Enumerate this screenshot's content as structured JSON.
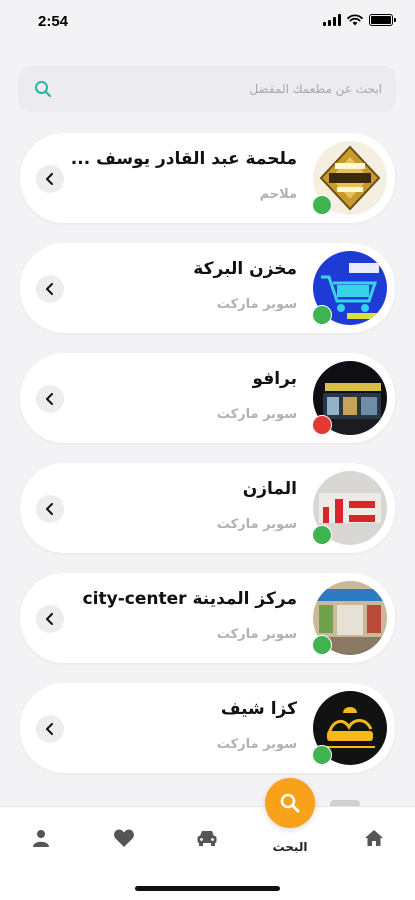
{
  "status_bar": {
    "time": "2:54"
  },
  "search": {
    "placeholder": "ابحث عن مطعمك المفضل"
  },
  "colors": {
    "accent": "#f7a21a",
    "online": "#3fb34f",
    "offline": "#e53935",
    "search_icon": "#27b3a8"
  },
  "stores": [
    {
      "name": "ملحمة عبد القادر يوسف ...",
      "category": "ملاحم",
      "status": "open",
      "icon": "butcher-logo"
    },
    {
      "name": "مخزن البركة",
      "category": "سوبر ماركت",
      "status": "open",
      "icon": "cart-logo"
    },
    {
      "name": "برافو",
      "category": "سوبر ماركت",
      "status": "closed",
      "icon": "storefront-photo"
    },
    {
      "name": "المازن",
      "category": "سوبر ماركت",
      "status": "open",
      "icon": "mazen-logo"
    },
    {
      "name": "مركز المدينة city-center",
      "category": "سوبر ماركت",
      "status": "open",
      "icon": "shop-photo"
    },
    {
      "name": "كزا شيف",
      "category": "سوبر ماركت",
      "status": "open",
      "icon": "chef-logo"
    }
  ],
  "nav": {
    "active_label": "البحث",
    "items": [
      "home-icon",
      "search-icon",
      "car-icon",
      "heart-icon",
      "user-icon"
    ]
  }
}
